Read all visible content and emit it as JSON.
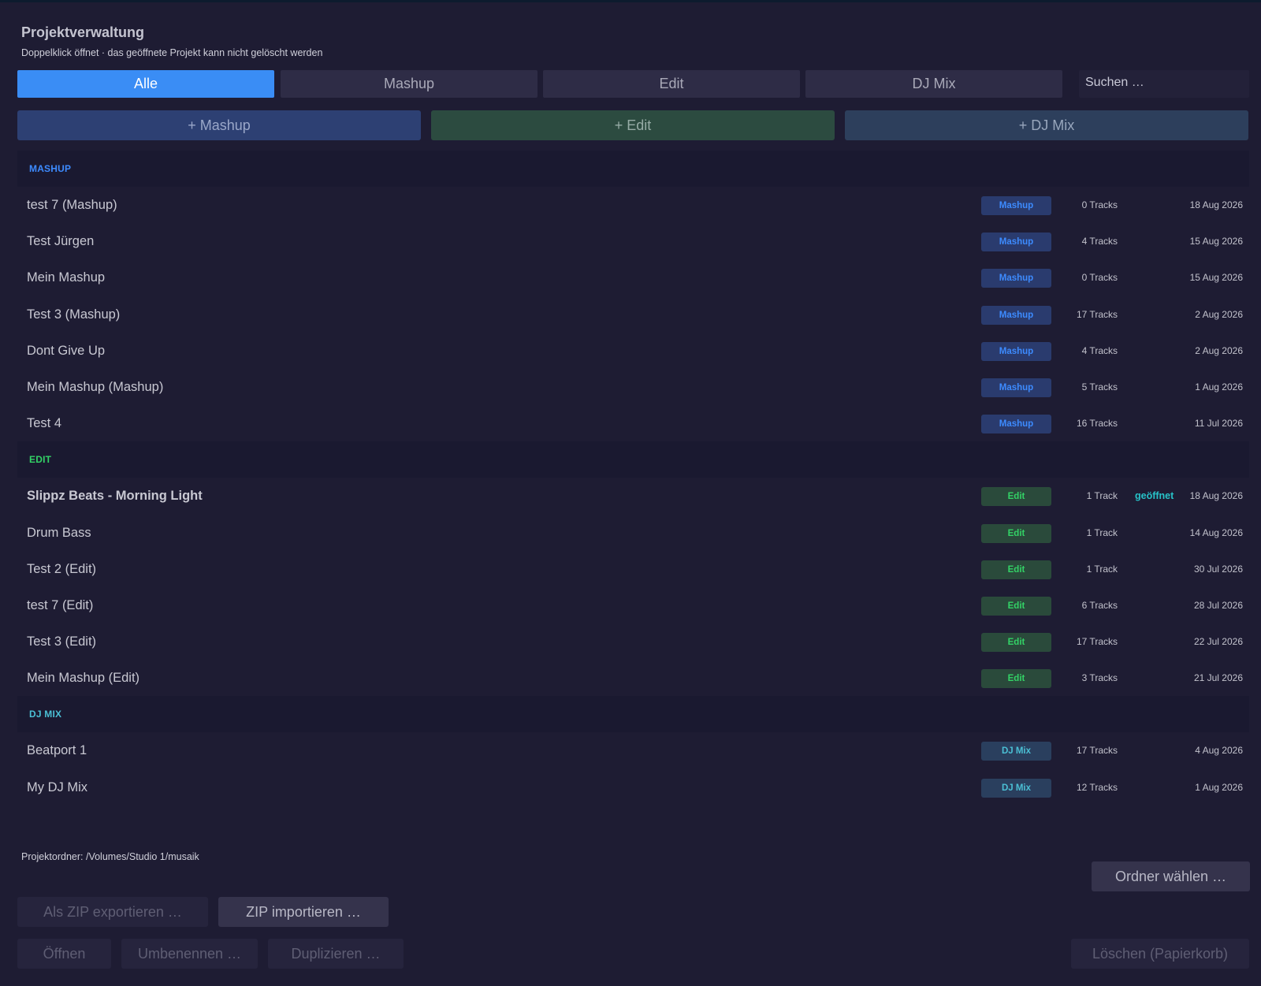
{
  "header": {
    "title": "Projektverwaltung",
    "subtitle": "Doppelklick öffnet · das geöffnete Projekt kann nicht gelöscht werden"
  },
  "filter_tabs": [
    {
      "label": "Alle",
      "active": true
    },
    {
      "label": "Mashup",
      "active": false
    },
    {
      "label": "Edit",
      "active": false
    },
    {
      "label": "DJ Mix",
      "active": false
    }
  ],
  "search": {
    "placeholder": "Suchen …"
  },
  "new_buttons": {
    "mashup": "+ Mashup",
    "edit": "+ Edit",
    "djmix": "+ DJ Mix"
  },
  "colors": {
    "accent": "#3a8df5",
    "mashup": "#3d8bff",
    "edit": "#33d266",
    "djmix": "#4bbfd4",
    "opened": "#27c2c8"
  },
  "sections": [
    {
      "key": "mashup",
      "header": "MASHUP",
      "rows": [
        {
          "name": "test 7 (Mashup)",
          "badge": "Mashup",
          "tracks": "0 Tracks",
          "date": "18 Aug 2026"
        },
        {
          "name": "Test Jürgen",
          "badge": "Mashup",
          "tracks": "4 Tracks",
          "date": "15 Aug 2026"
        },
        {
          "name": "Mein Mashup",
          "badge": "Mashup",
          "tracks": "0 Tracks",
          "date": "15 Aug 2026"
        },
        {
          "name": "Test 3 (Mashup)",
          "badge": "Mashup",
          "tracks": "17 Tracks",
          "date": "2 Aug 2026"
        },
        {
          "name": "Dont Give Up",
          "badge": "Mashup",
          "tracks": "4 Tracks",
          "date": "2 Aug 2026"
        },
        {
          "name": "Mein Mashup (Mashup)",
          "badge": "Mashup",
          "tracks": "5 Tracks",
          "date": "1 Aug 2026"
        },
        {
          "name": "Test 4",
          "badge": "Mashup",
          "tracks": "16 Tracks",
          "date": "11 Jul 2026"
        }
      ]
    },
    {
      "key": "edit",
      "header": "EDIT",
      "rows": [
        {
          "name": "Slippz Beats - Morning Light",
          "badge": "Edit",
          "tracks": "1 Track",
          "opened": "geöffnet",
          "date": "18 Aug 2026",
          "bold": true
        },
        {
          "name": "Drum Bass",
          "badge": "Edit",
          "tracks": "1 Track",
          "date": "14 Aug 2026"
        },
        {
          "name": "Test 2 (Edit)",
          "badge": "Edit",
          "tracks": "1 Track",
          "date": "30 Jul 2026"
        },
        {
          "name": "test 7 (Edit)",
          "badge": "Edit",
          "tracks": "6 Tracks",
          "date": "28 Jul 2026"
        },
        {
          "name": "Test 3 (Edit)",
          "badge": "Edit",
          "tracks": "17 Tracks",
          "date": "22 Jul 2026"
        },
        {
          "name": "Mein Mashup (Edit)",
          "badge": "Edit",
          "tracks": "3 Tracks",
          "date": "21 Jul 2026"
        }
      ]
    },
    {
      "key": "djmix",
      "header": "DJ MIX",
      "rows": [
        {
          "name": "Beatport 1",
          "badge": "DJ Mix",
          "tracks": "17 Tracks",
          "date": "4 Aug 2026"
        },
        {
          "name": "My DJ Mix",
          "badge": "DJ Mix",
          "tracks": "12 Tracks",
          "date": "1 Aug 2026"
        }
      ]
    }
  ],
  "footer": {
    "folder_path": "Projektordner: /Volumes/Studio 1/musaik",
    "choose_folder": "Ordner wählen …",
    "export_zip": "Als ZIP exportieren …",
    "import_zip": "ZIP importieren …",
    "open": "Öffnen",
    "rename": "Umbenennen …",
    "duplicate": "Duplizieren …",
    "delete": "Löschen (Papierkorb)"
  }
}
